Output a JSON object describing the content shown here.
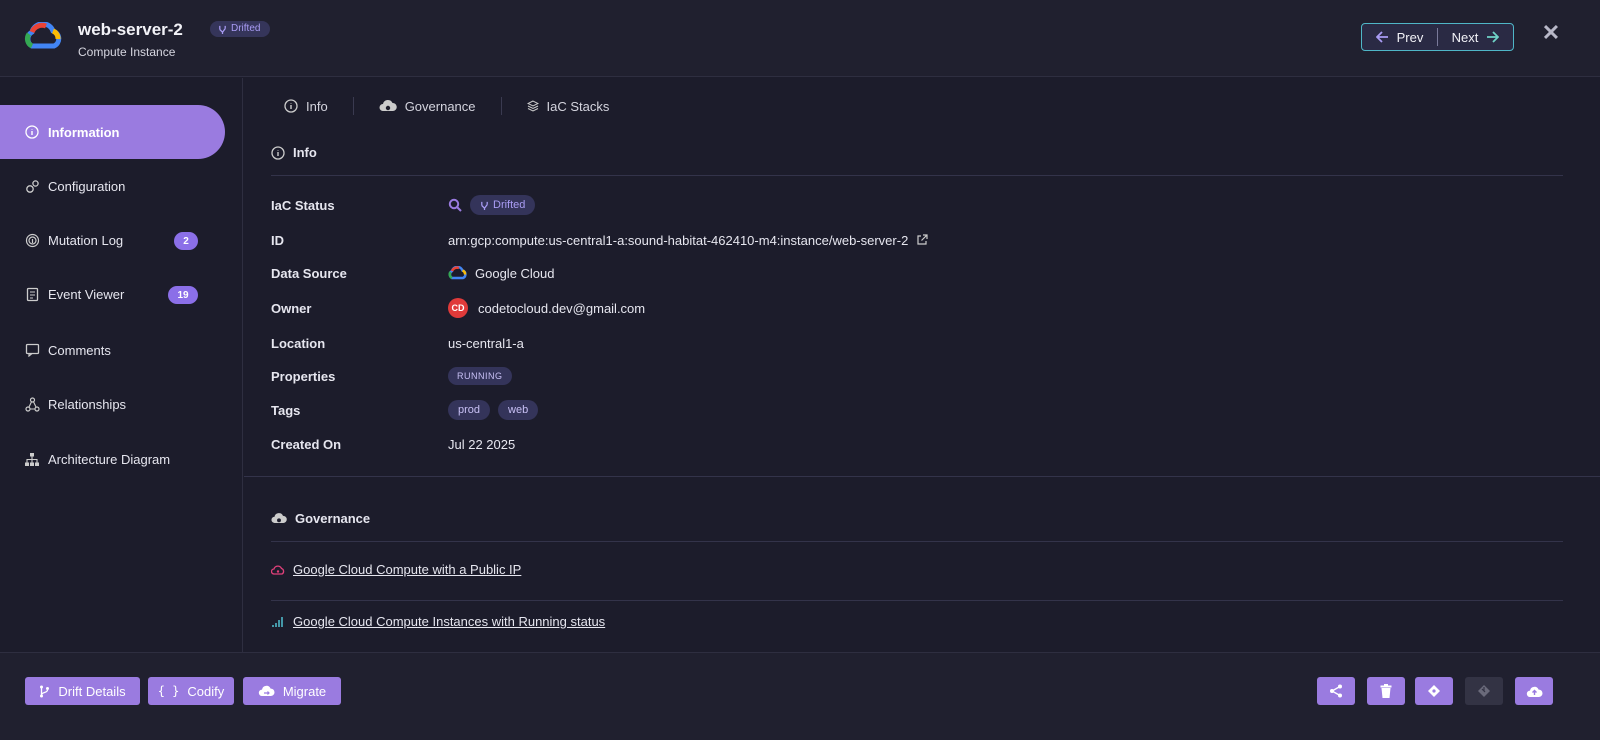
{
  "header": {
    "title": "web-server-2",
    "subtitle": "Compute Instance",
    "badge": "Drifted",
    "prev_label": "Prev",
    "next_label": "Next",
    "logo_icon": "google-cloud-logo",
    "close_icon": "close-icon"
  },
  "sidebar": {
    "items": [
      {
        "label": "Information",
        "icon": "info-icon",
        "active": true
      },
      {
        "label": "Configuration",
        "icon": "gears-icon"
      },
      {
        "label": "Mutation Log",
        "icon": "fingerprint-icon",
        "count": "2"
      },
      {
        "label": "Event Viewer",
        "icon": "document-icon",
        "count": "19"
      },
      {
        "label": "Comments",
        "icon": "comments-icon"
      },
      {
        "label": "Relationships",
        "icon": "relationships-icon"
      },
      {
        "label": "Architecture Diagram",
        "icon": "sitemap-icon"
      }
    ]
  },
  "tabs": [
    {
      "label": "Info",
      "icon": "info-icon"
    },
    {
      "label": "Governance",
      "icon": "cloud-shield-icon"
    },
    {
      "label": "IaC Stacks",
      "icon": "layers-icon"
    }
  ],
  "info": {
    "section_title": "Info",
    "rows": {
      "iac_status": {
        "label": "IaC Status",
        "badge": "Drifted"
      },
      "id": {
        "label": "ID",
        "value": "arn:gcp:compute:us-central1-a:sound-habitat-462410-m4:instance/web-server-2"
      },
      "data_source": {
        "label": "Data Source",
        "value": "Google Cloud"
      },
      "owner": {
        "label": "Owner",
        "avatar": "CD",
        "value": "codetocloud.dev@gmail.com"
      },
      "location": {
        "label": "Location",
        "value": "us-central1-a"
      },
      "properties": {
        "label": "Properties",
        "value": "RUNNING"
      },
      "tags": {
        "label": "Tags",
        "values": [
          "prod",
          "web"
        ]
      },
      "created_on": {
        "label": "Created On",
        "value": "Jul 22 2025"
      }
    }
  },
  "governance": {
    "section_title": "Governance",
    "items": [
      {
        "label": "Google Cloud Compute with a Public IP",
        "icon": "alert-cloud-icon",
        "color": "#e0407a"
      },
      {
        "label": "Google Cloud Compute Instances with Running status",
        "icon": "signal-bars-icon",
        "color": "#4fb6c7"
      }
    ]
  },
  "footer": {
    "drift_details": "Drift Details",
    "codify": "Codify",
    "migrate": "Migrate",
    "icon_buttons": [
      "share-icon",
      "trash-icon",
      "diamond-icon",
      "git-icon",
      "cloud-upload-icon"
    ]
  },
  "colors": {
    "accent": "#9a7be0",
    "background": "#1c1c2b",
    "badge_text": "#a99cf4",
    "nav_border": "#4fb6c7"
  }
}
